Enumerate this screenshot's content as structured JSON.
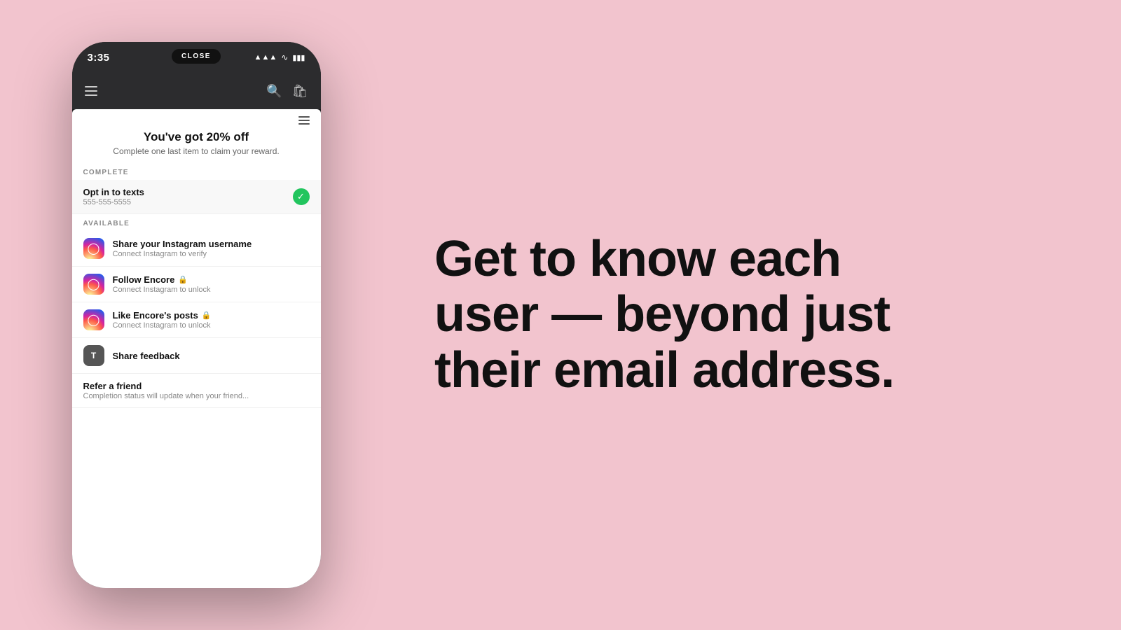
{
  "background_color": "#f2c4ce",
  "left": {
    "phone": {
      "status_bar": {
        "time": "3:35",
        "signal": "▲▲▲",
        "wifi": "wifi",
        "battery": "battery"
      },
      "close_label": "CLOSE",
      "nav": {
        "search_label": "search",
        "bag_label": "bag"
      },
      "content": {
        "menu_icon": "menu",
        "reward_title": "You've got 20% off",
        "reward_subtitle": "Complete one last item to claim your reward.",
        "complete_section": {
          "label": "COMPLETE",
          "items": [
            {
              "icon_type": "none",
              "title": "Opt in to texts",
              "sub": "555-555-5555",
              "completed": true
            }
          ]
        },
        "available_section": {
          "label": "AVAILABLE",
          "items": [
            {
              "icon_type": "instagram",
              "title": "Share your Instagram username",
              "sub": "Connect Instagram to verify",
              "locked": false,
              "completed": false
            },
            {
              "icon_type": "instagram",
              "title": "Follow Encore",
              "sub": "Connect Instagram to unlock",
              "locked": true,
              "completed": false
            },
            {
              "icon_type": "instagram",
              "title": "Like Encore's posts",
              "sub": "Connect Instagram to unlock",
              "locked": true,
              "completed": false
            },
            {
              "icon_type": "text",
              "icon_letter": "T",
              "title": "Share feedback",
              "sub": "",
              "locked": false,
              "completed": false
            },
            {
              "icon_type": "none",
              "title": "Refer a friend",
              "sub": "Completion status will update when your friend...",
              "locked": false,
              "completed": false
            }
          ]
        }
      }
    }
  },
  "right": {
    "tagline_line1": "Get to know each",
    "tagline_line2": "user — beyond just",
    "tagline_line3": "their email address."
  }
}
